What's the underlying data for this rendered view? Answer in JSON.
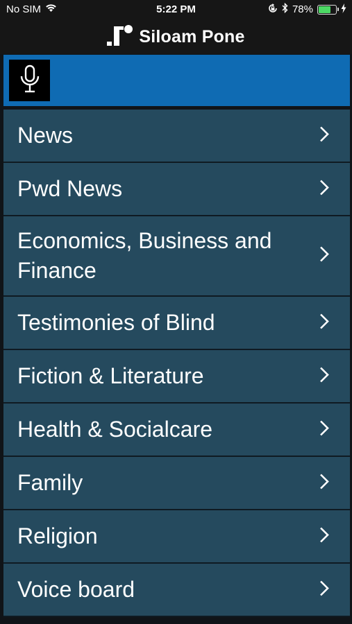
{
  "status_bar": {
    "carrier": "No SIM",
    "time": "5:22 PM",
    "battery_percent": "78%",
    "battery_level": 0.78,
    "icons": [
      "wifi-icon",
      "orientation-lock-icon",
      "bluetooth-icon",
      "battery-icon",
      "charging-bolt-icon"
    ]
  },
  "header": {
    "title": "Siloam Pone",
    "logo": "siloam-logo"
  },
  "search": {
    "icon": "microphone-icon"
  },
  "menu": {
    "items": [
      {
        "label": "News"
      },
      {
        "label": "Pwd News"
      },
      {
        "label": "Economics, Business and Finance"
      },
      {
        "label": "Testimonies of Blind"
      },
      {
        "label": "Fiction & Literature"
      },
      {
        "label": "Health & Socialcare"
      },
      {
        "label": "Family"
      },
      {
        "label": "Religion"
      },
      {
        "label": "Voice board"
      }
    ],
    "chevron_icon": "chevron-right-icon"
  },
  "colors": {
    "search_bar": "#0f6bb3",
    "menu_item": "#254a5e",
    "background": "#161616",
    "battery": "#4cd964"
  }
}
